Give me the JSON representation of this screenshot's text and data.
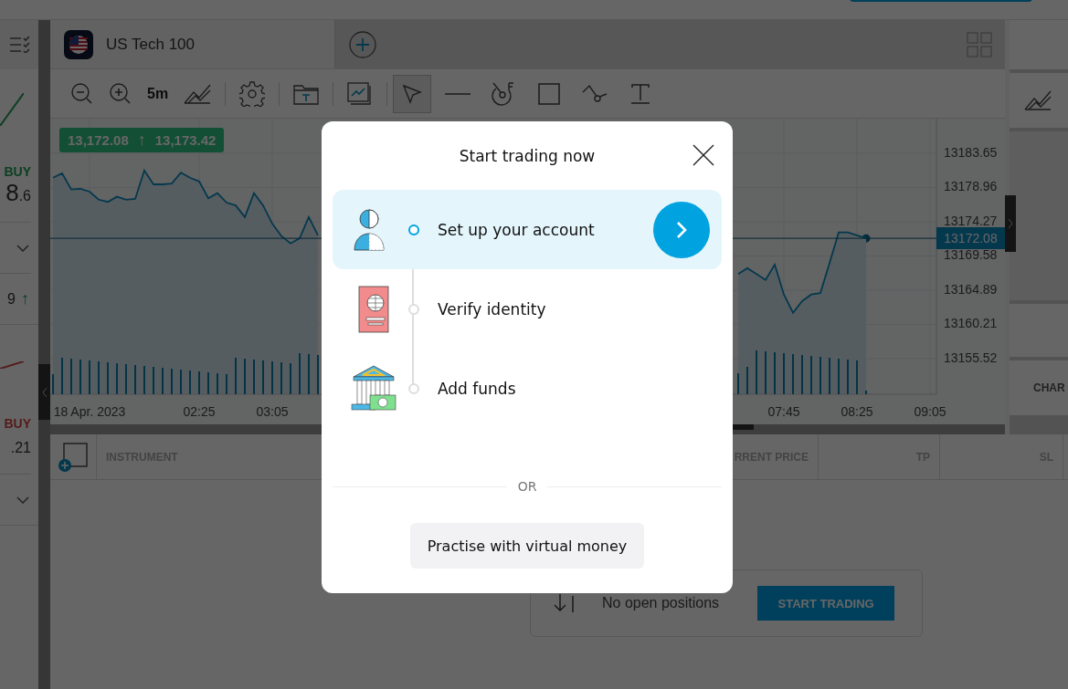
{
  "watchlist": {
    "items": [
      {
        "kind": "up",
        "side": "BUY",
        "price_main": "8",
        "price_small": ".6",
        "change": "9",
        "change_arrow": "↑"
      },
      {
        "kind": "down",
        "side": "BUY",
        "price_small": ".21"
      }
    ]
  },
  "tabs": [
    {
      "label": "US Tech 100",
      "selected": true
    }
  ],
  "toolbar": {
    "interval": "5m",
    "tools": [
      {
        "kind": "cursor",
        "selected": true
      },
      {
        "kind": "line",
        "selected": false
      },
      {
        "kind": "fibonacci",
        "selected": false
      },
      {
        "kind": "rectangle",
        "selected": false
      },
      {
        "kind": "path",
        "selected": false
      },
      {
        "kind": "text",
        "selected": false
      }
    ]
  },
  "chart": {
    "bid": "13,172.08",
    "arrow": "↑",
    "ask": "13,173.42",
    "current_price": "13172.08",
    "chart_data": {
      "type": "area",
      "grid": true,
      "ylim": [
        13150.63,
        13188.4
      ],
      "yticks": [
        13183.65,
        13178.96,
        13174.27,
        13169.58,
        13164.89,
        13160.21,
        13155.52
      ],
      "categories": [
        null,
        null,
        null,
        null,
        "18 Apr. 2023",
        null,
        null,
        null,
        null,
        null,
        null,
        null,
        null,
        null,
        null,
        null,
        "02:25",
        null,
        null,
        null,
        null,
        null,
        null,
        null,
        "03:05",
        null,
        null,
        null,
        null,
        null,
        null,
        null,
        null,
        null,
        null,
        null,
        null,
        null,
        null,
        null,
        null,
        null,
        null,
        null,
        null,
        null,
        null,
        null,
        null,
        null,
        null,
        null,
        null,
        null,
        null,
        null,
        null,
        null,
        null,
        null,
        null,
        null,
        null,
        null,
        null,
        null,
        null,
        null,
        null,
        null,
        null,
        null,
        null,
        null,
        null,
        null,
        null,
        null,
        null,
        null,
        "07:45",
        null,
        null,
        null,
        null,
        null,
        null,
        null,
        "08:25",
        null,
        null,
        null,
        null,
        null,
        null,
        null,
        "09:05"
      ],
      "series": [
        {
          "color": "#0b8cc0",
          "values": [
            13180.3,
            13180.9,
            13178.7,
            13178.8,
            13178.4,
            13177.3,
            13177.0,
            13177.7,
            13177.3,
            13177.4,
            13181.3,
            13179.4,
            13179.4,
            13179.5,
            13181.0,
            13180.3,
            13179.8,
            13177.5,
            13178.2,
            13176.9,
            13176.5,
            13174.9,
            13178.2,
            13176.5,
            13174.0,
            13172.3,
            13171.3,
            13172.0,
            13174.9,
            13172.4,
            null,
            null,
            null,
            null,
            null,
            null,
            null,
            null,
            null,
            null,
            null,
            null,
            null,
            null,
            null,
            null,
            null,
            null,
            null,
            null,
            null,
            null,
            null,
            null,
            null,
            null,
            null,
            null,
            null,
            null,
            null,
            null,
            null,
            null,
            null,
            null,
            null,
            null,
            null,
            null,
            null,
            null,
            null,
            null,
            null,
            13167.1,
            13167.9,
            13167.1,
            13166.3,
            13168.4,
            13164.3,
            13161.8,
            13163.4,
            13164.3,
            13164.5,
            13168.6,
            13172.8,
            13172.8,
            13172.4,
            13172.0,
            null,
            null,
            null,
            null,
            null,
            null,
            null
          ]
        }
      ]
    }
  },
  "right_panel": {
    "tab": "CHAR"
  },
  "positions": {
    "columns": [
      "INSTRUMENT",
      "RRENT PRICE",
      "TP",
      "SL"
    ],
    "empty_text": "No open positions",
    "button": "START TRADING"
  },
  "modal": {
    "title": "Start trading now",
    "steps": [
      {
        "kind": "account",
        "label": "Set up your account",
        "selected": true
      },
      {
        "kind": "identity",
        "label": "Verify identity",
        "selected": false
      },
      {
        "kind": "funds",
        "label": "Add funds",
        "selected": false
      }
    ],
    "divider": "OR",
    "button": "Practise with virtual money"
  }
}
